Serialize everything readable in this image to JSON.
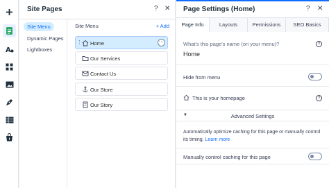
{
  "colors": {
    "accent": "#116dff",
    "selected_bg": "#d3edff",
    "text": "#2b2b2b"
  },
  "rail": {
    "items": [
      {
        "name": "add-icon"
      },
      {
        "name": "pages-icon"
      },
      {
        "name": "theme-icon"
      },
      {
        "name": "apps-icon"
      },
      {
        "name": "media-icon"
      },
      {
        "name": "blog-icon"
      },
      {
        "name": "table-icon"
      },
      {
        "name": "store-icon"
      }
    ]
  },
  "pages_panel": {
    "title": "Site Pages",
    "help": "?",
    "close": "✕",
    "nav": [
      "Site Menu",
      "Dynamic Pages",
      "Lightboxes"
    ],
    "menu_label": "Site Menu",
    "add_label": "+ Add",
    "items": [
      {
        "label": "Home",
        "icon": "home-icon"
      },
      {
        "label": "Our Services",
        "icon": "folder-icon"
      },
      {
        "label": "Contact Us",
        "icon": "mail-icon"
      },
      {
        "label": "Our Store",
        "icon": "anchor-icon"
      },
      {
        "label": "Our Story",
        "icon": "page-icon"
      }
    ],
    "more": "···",
    "drag": "⋮"
  },
  "settings_panel": {
    "title": "Page Settings (Home)",
    "help": "?",
    "close": "✕",
    "tabs": [
      "Page Info",
      "Layouts",
      "Permissions",
      "SEO Basics"
    ],
    "page_name_label": "What's this page's name (on your menu)?",
    "page_name_value": "Home",
    "hide_label": "Hide from menu",
    "homepage_label": "This is your homepage",
    "advanced_label": "Advanced Settings",
    "advanced_caret": "▼",
    "caching_desc": "Automatically optimize caching for this page or manually control its timing.",
    "learn_more": "Learn more",
    "manual_caching_label": "Manually control caching for this page",
    "info": "?"
  }
}
